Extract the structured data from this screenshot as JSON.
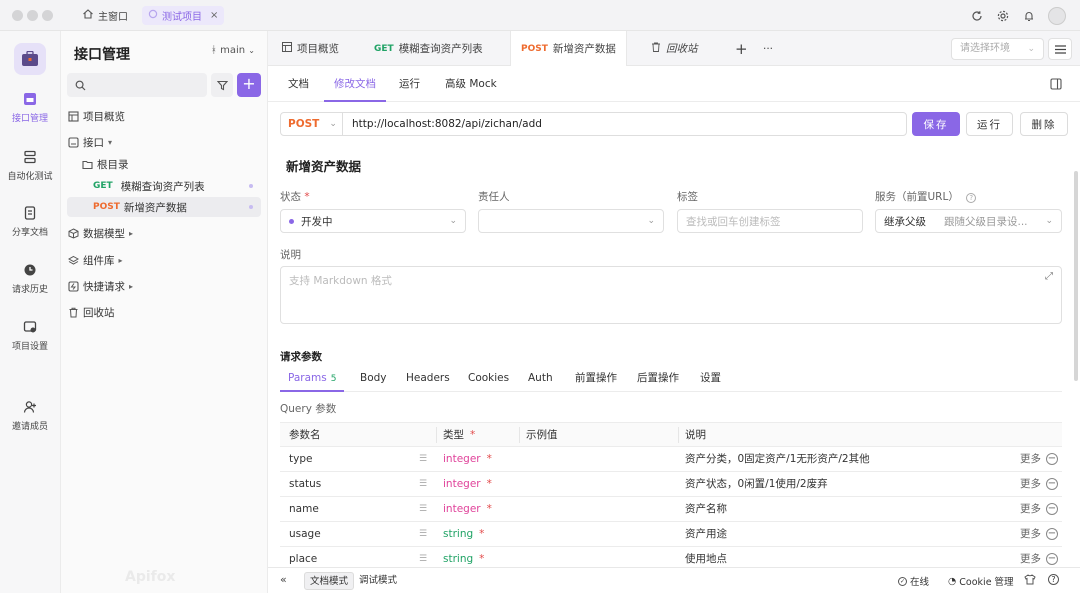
{
  "titlebar": {
    "home_tab": "主窗口",
    "project_tab": "测试项目",
    "project_close": "×"
  },
  "rail": {
    "items": [
      {
        "label": "接口管理",
        "icon": "api-icon"
      },
      {
        "label": "自动化测试",
        "icon": "automation-icon"
      },
      {
        "label": "分享文档",
        "icon": "share-doc-icon"
      },
      {
        "label": "请求历史",
        "icon": "history-icon"
      },
      {
        "label": "项目设置",
        "icon": "settings-icon"
      },
      {
        "label": "邀请成员",
        "icon": "invite-icon"
      }
    ]
  },
  "sidebar": {
    "title": "接口管理",
    "branch": "main",
    "tree": {
      "overview": "项目概览",
      "api": "接口",
      "root": "根目录",
      "item1": {
        "method": "GET",
        "name": "模糊查询资产列表"
      },
      "item2": {
        "method": "POST",
        "name": "新增资产数据"
      },
      "models": "数据模型",
      "components": "组件库",
      "quick": "快捷请求",
      "trash": "回收站"
    },
    "watermark": "Apifox"
  },
  "tabs": {
    "t1": "项目概览",
    "t2_method": "GET",
    "t2": "模糊查询资产列表",
    "t3_method": "POST",
    "t3": "新增资产数据",
    "t4": "回收站",
    "add": "+",
    "more": "···",
    "env_placeholder": "请选择环境"
  },
  "subtabs": {
    "doc": "文档",
    "edit": "修改文档",
    "run": "运行",
    "mock": "高级 Mock"
  },
  "request": {
    "method": "POST",
    "url": "http://localhost:8082/api/zichan/add",
    "save": "保存",
    "run": "运行",
    "delete": "删除"
  },
  "doc": {
    "title": "新增资产数据",
    "status_label": "状态",
    "status_value": "开发中",
    "owner_label": "责任人",
    "tag_label": "标签",
    "tag_placeholder": "查找或回车创建标签",
    "service_label": "服务（前置URL）",
    "service_value": "继承父级",
    "service_hint": "跟随父级目录设...",
    "desc_label": "说明",
    "desc_placeholder": "支持 Markdown 格式"
  },
  "params": {
    "section_title": "请求参数",
    "tabs": {
      "params": "Params",
      "params_count": "5",
      "body": "Body",
      "headers": "Headers",
      "cookies": "Cookies",
      "auth": "Auth",
      "pre": "前置操作",
      "post": "后置操作",
      "settings": "设置"
    },
    "query_label": "Query 参数",
    "header": {
      "name": "参数名",
      "type": "类型",
      "example": "示例值",
      "desc": "说明"
    },
    "more_label": "更多",
    "rows": [
      {
        "name": "type",
        "type": "integer",
        "desc": "资产分类，0固定资产/1无形资产/2其他"
      },
      {
        "name": "status",
        "type": "integer",
        "desc": "资产状态，0闲置/1使用/2废弃"
      },
      {
        "name": "name",
        "type": "integer",
        "desc": "资产名称"
      },
      {
        "name": "usage",
        "type": "string",
        "desc": "资产用途"
      },
      {
        "name": "place",
        "type": "string",
        "desc": "使用地点"
      }
    ]
  },
  "footer": {
    "doc_mode": "文档模式",
    "debug_mode": "调试模式",
    "online": "在线",
    "cookie": "Cookie 管理"
  },
  "colors": {
    "accent": "#8a67e6",
    "get": "#21a366",
    "post": "#ee6b2f",
    "integer": "#e0429a"
  }
}
